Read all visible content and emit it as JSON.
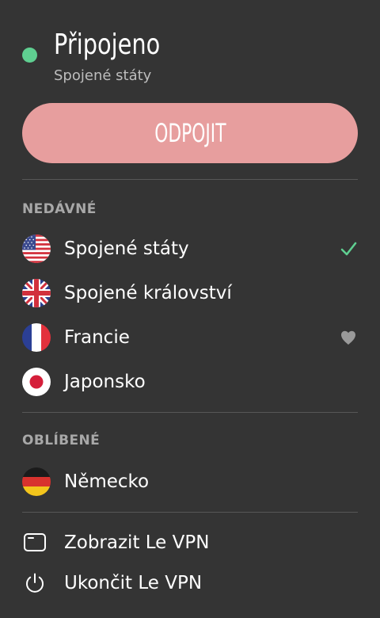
{
  "status": {
    "title": "Připojeno",
    "location": "Spojené státy",
    "indicator_color": "#5fcf91"
  },
  "disconnect_button": {
    "label": "ODPOJIT",
    "color": "#e79e9e"
  },
  "recent": {
    "title": "NEDÁVNÉ",
    "items": [
      {
        "label": "Spojené státy",
        "flag_icon": "us-flag-icon",
        "trailing_icon": "checkmark-icon",
        "selected": true
      },
      {
        "label": "Spojené království",
        "flag_icon": "uk-flag-icon"
      },
      {
        "label": "Francie",
        "flag_icon": "france-flag-icon",
        "trailing_icon": "heart-icon",
        "favorite": true
      },
      {
        "label": "Japonsko",
        "flag_icon": "japan-flag-icon"
      }
    ]
  },
  "favorites": {
    "title": "OBLÍBENÉ",
    "items": [
      {
        "label": "Německo",
        "flag_icon": "germany-flag-icon"
      }
    ]
  },
  "menu": {
    "items": [
      {
        "label": "Zobrazit Le VPN",
        "icon": "window-icon"
      },
      {
        "label": "Ukončit Le VPN",
        "icon": "power-icon"
      }
    ]
  },
  "colors": {
    "background": "#343434",
    "divider": "#575757",
    "section_title": "#a8a8a8",
    "accent_green": "#5fcf91"
  }
}
